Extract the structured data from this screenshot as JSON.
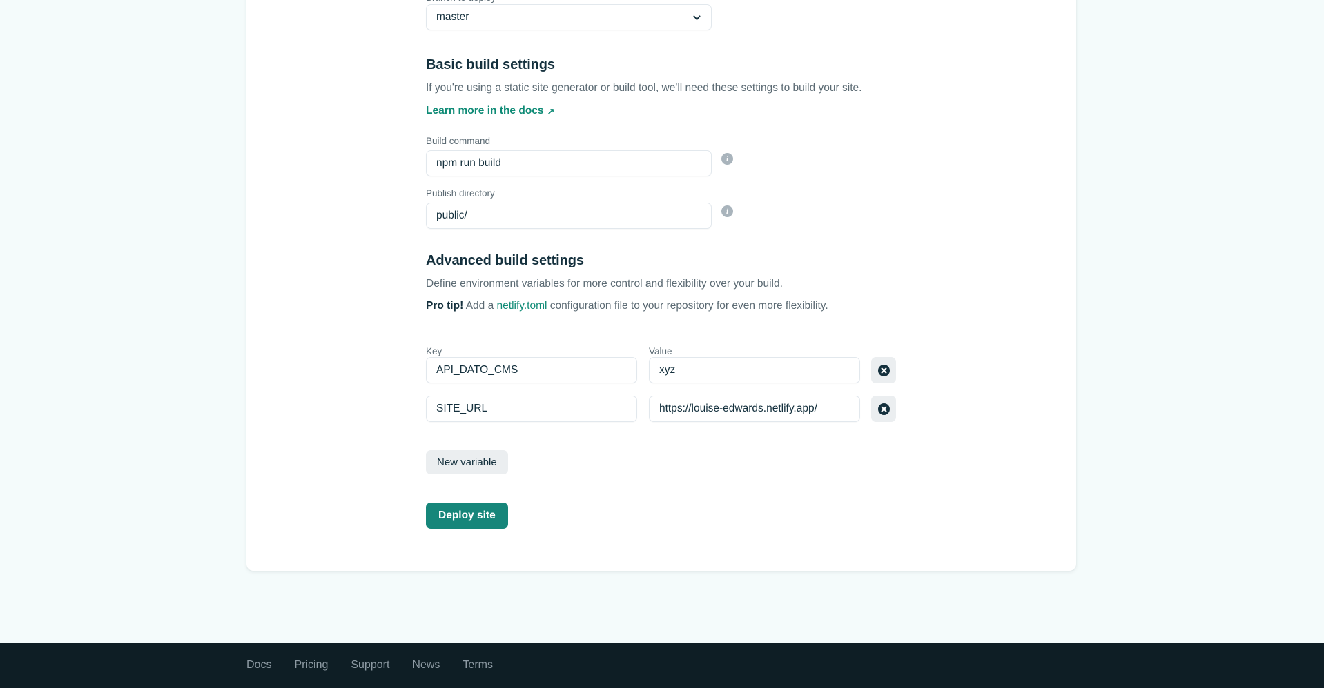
{
  "branch": {
    "label": "Branch to deploy",
    "value": "master",
    "options": [
      "master"
    ],
    "chevron_icon": "chevron-down-icon"
  },
  "basic_build": {
    "heading": "Basic build settings",
    "description": "If you're using a static site generator or build tool, we'll need these settings to build your site.",
    "docs_link": "Learn more in the docs",
    "external_arrow": "↗",
    "build_command": {
      "label": "Build command",
      "value": "npm run build",
      "info_icon": "info-icon"
    },
    "publish_directory": {
      "label": "Publish directory",
      "value": "public/",
      "info_icon": "info-icon"
    }
  },
  "advanced_build": {
    "heading": "Advanced build settings",
    "description": "Define environment variables for more control and flexibility over your build.",
    "protip_label": "Pro tip!",
    "protip_before": " Add a ",
    "protip_link": "netlify.toml",
    "protip_after": " configuration file to your repository for even more flexibility.",
    "columns": {
      "key": "Key",
      "value": "Value"
    },
    "variables": [
      {
        "key": "API_DATO_CMS",
        "value": "xyz",
        "delete_icon": "close-circle-icon"
      },
      {
        "key": "SITE_URL",
        "value": "https://louise-edwards.netlify.app/",
        "delete_icon": "close-circle-icon"
      }
    ],
    "new_variable_label": "New variable"
  },
  "deploy": {
    "label": "Deploy site"
  },
  "footer": {
    "links": [
      "Docs",
      "Pricing",
      "Support",
      "News",
      "Terms"
    ]
  },
  "colors": {
    "accent_teal": "#16867a",
    "link_teal": "#0f8b76",
    "page_bg": "#f4fbfb",
    "card_bg": "#ffffff",
    "footer_bg": "#0e1e25",
    "muted_text": "#5b6a73",
    "dark_text": "#14303d",
    "button_grey": "#ebeef0"
  }
}
